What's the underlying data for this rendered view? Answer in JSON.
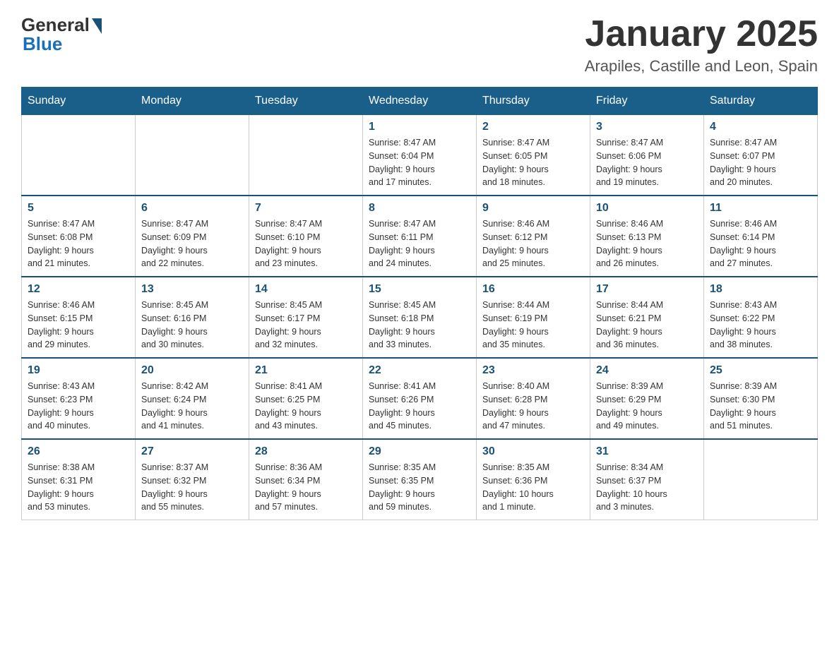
{
  "header": {
    "logo_general": "General",
    "logo_blue": "Blue",
    "month_title": "January 2025",
    "location": "Arapiles, Castille and Leon, Spain"
  },
  "weekdays": [
    "Sunday",
    "Monday",
    "Tuesday",
    "Wednesday",
    "Thursday",
    "Friday",
    "Saturday"
  ],
  "weeks": [
    [
      {
        "day": "",
        "info": ""
      },
      {
        "day": "",
        "info": ""
      },
      {
        "day": "",
        "info": ""
      },
      {
        "day": "1",
        "info": "Sunrise: 8:47 AM\nSunset: 6:04 PM\nDaylight: 9 hours\nand 17 minutes."
      },
      {
        "day": "2",
        "info": "Sunrise: 8:47 AM\nSunset: 6:05 PM\nDaylight: 9 hours\nand 18 minutes."
      },
      {
        "day": "3",
        "info": "Sunrise: 8:47 AM\nSunset: 6:06 PM\nDaylight: 9 hours\nand 19 minutes."
      },
      {
        "day": "4",
        "info": "Sunrise: 8:47 AM\nSunset: 6:07 PM\nDaylight: 9 hours\nand 20 minutes."
      }
    ],
    [
      {
        "day": "5",
        "info": "Sunrise: 8:47 AM\nSunset: 6:08 PM\nDaylight: 9 hours\nand 21 minutes."
      },
      {
        "day": "6",
        "info": "Sunrise: 8:47 AM\nSunset: 6:09 PM\nDaylight: 9 hours\nand 22 minutes."
      },
      {
        "day": "7",
        "info": "Sunrise: 8:47 AM\nSunset: 6:10 PM\nDaylight: 9 hours\nand 23 minutes."
      },
      {
        "day": "8",
        "info": "Sunrise: 8:47 AM\nSunset: 6:11 PM\nDaylight: 9 hours\nand 24 minutes."
      },
      {
        "day": "9",
        "info": "Sunrise: 8:46 AM\nSunset: 6:12 PM\nDaylight: 9 hours\nand 25 minutes."
      },
      {
        "day": "10",
        "info": "Sunrise: 8:46 AM\nSunset: 6:13 PM\nDaylight: 9 hours\nand 26 minutes."
      },
      {
        "day": "11",
        "info": "Sunrise: 8:46 AM\nSunset: 6:14 PM\nDaylight: 9 hours\nand 27 minutes."
      }
    ],
    [
      {
        "day": "12",
        "info": "Sunrise: 8:46 AM\nSunset: 6:15 PM\nDaylight: 9 hours\nand 29 minutes."
      },
      {
        "day": "13",
        "info": "Sunrise: 8:45 AM\nSunset: 6:16 PM\nDaylight: 9 hours\nand 30 minutes."
      },
      {
        "day": "14",
        "info": "Sunrise: 8:45 AM\nSunset: 6:17 PM\nDaylight: 9 hours\nand 32 minutes."
      },
      {
        "day": "15",
        "info": "Sunrise: 8:45 AM\nSunset: 6:18 PM\nDaylight: 9 hours\nand 33 minutes."
      },
      {
        "day": "16",
        "info": "Sunrise: 8:44 AM\nSunset: 6:19 PM\nDaylight: 9 hours\nand 35 minutes."
      },
      {
        "day": "17",
        "info": "Sunrise: 8:44 AM\nSunset: 6:21 PM\nDaylight: 9 hours\nand 36 minutes."
      },
      {
        "day": "18",
        "info": "Sunrise: 8:43 AM\nSunset: 6:22 PM\nDaylight: 9 hours\nand 38 minutes."
      }
    ],
    [
      {
        "day": "19",
        "info": "Sunrise: 8:43 AM\nSunset: 6:23 PM\nDaylight: 9 hours\nand 40 minutes."
      },
      {
        "day": "20",
        "info": "Sunrise: 8:42 AM\nSunset: 6:24 PM\nDaylight: 9 hours\nand 41 minutes."
      },
      {
        "day": "21",
        "info": "Sunrise: 8:41 AM\nSunset: 6:25 PM\nDaylight: 9 hours\nand 43 minutes."
      },
      {
        "day": "22",
        "info": "Sunrise: 8:41 AM\nSunset: 6:26 PM\nDaylight: 9 hours\nand 45 minutes."
      },
      {
        "day": "23",
        "info": "Sunrise: 8:40 AM\nSunset: 6:28 PM\nDaylight: 9 hours\nand 47 minutes."
      },
      {
        "day": "24",
        "info": "Sunrise: 8:39 AM\nSunset: 6:29 PM\nDaylight: 9 hours\nand 49 minutes."
      },
      {
        "day": "25",
        "info": "Sunrise: 8:39 AM\nSunset: 6:30 PM\nDaylight: 9 hours\nand 51 minutes."
      }
    ],
    [
      {
        "day": "26",
        "info": "Sunrise: 8:38 AM\nSunset: 6:31 PM\nDaylight: 9 hours\nand 53 minutes."
      },
      {
        "day": "27",
        "info": "Sunrise: 8:37 AM\nSunset: 6:32 PM\nDaylight: 9 hours\nand 55 minutes."
      },
      {
        "day": "28",
        "info": "Sunrise: 8:36 AM\nSunset: 6:34 PM\nDaylight: 9 hours\nand 57 minutes."
      },
      {
        "day": "29",
        "info": "Sunrise: 8:35 AM\nSunset: 6:35 PM\nDaylight: 9 hours\nand 59 minutes."
      },
      {
        "day": "30",
        "info": "Sunrise: 8:35 AM\nSunset: 6:36 PM\nDaylight: 10 hours\nand 1 minute."
      },
      {
        "day": "31",
        "info": "Sunrise: 8:34 AM\nSunset: 6:37 PM\nDaylight: 10 hours\nand 3 minutes."
      },
      {
        "day": "",
        "info": ""
      }
    ]
  ]
}
